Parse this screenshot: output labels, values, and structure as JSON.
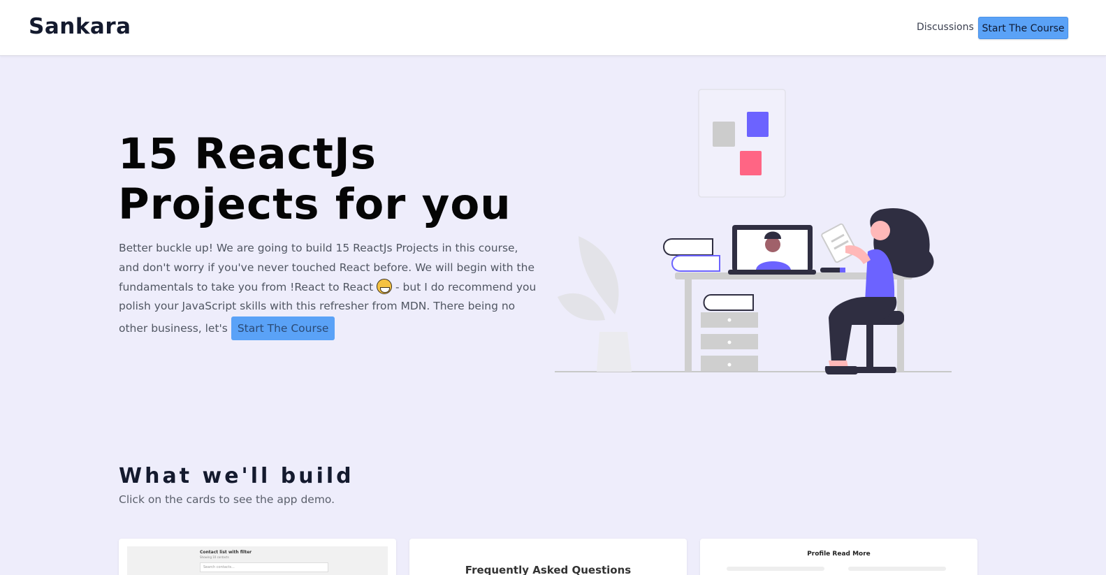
{
  "header": {
    "brand": "Sankara",
    "nav_link": "Discussions",
    "cta_label": "Start The Course"
  },
  "hero": {
    "title": "15 ReactJs Projects for you",
    "text_part1": "Better buckle up! We are going to build 15 ReactJs Projects in this course, and don't worry if you've never touched React before. We will begin with the fundamentals to take you from !React to React ",
    "text_part2": " - but I do recommend you polish your JavaScript skills with this refresher from MDN. There being no other business, let's ",
    "inline_cta_label": "Start The Course",
    "emoji_icon": "grinning-face-icon"
  },
  "colors": {
    "accent": "#5aa2f7",
    "background": "#eeedfb",
    "illustration_purple": "#6c63ff",
    "illustration_pink": "#ff6584"
  },
  "projects_section": {
    "title": "What we'll build",
    "subtitle": "Click on the cards to see the app demo.",
    "cards": [
      {
        "thumb_title": "Contact list with filter",
        "thumb_sub": "Showing 10 contacts",
        "thumb_input": "Search contacts..."
      },
      {
        "thumb_title": "Frequently Asked Questions"
      },
      {
        "thumb_title": "Profile Read More"
      }
    ]
  }
}
